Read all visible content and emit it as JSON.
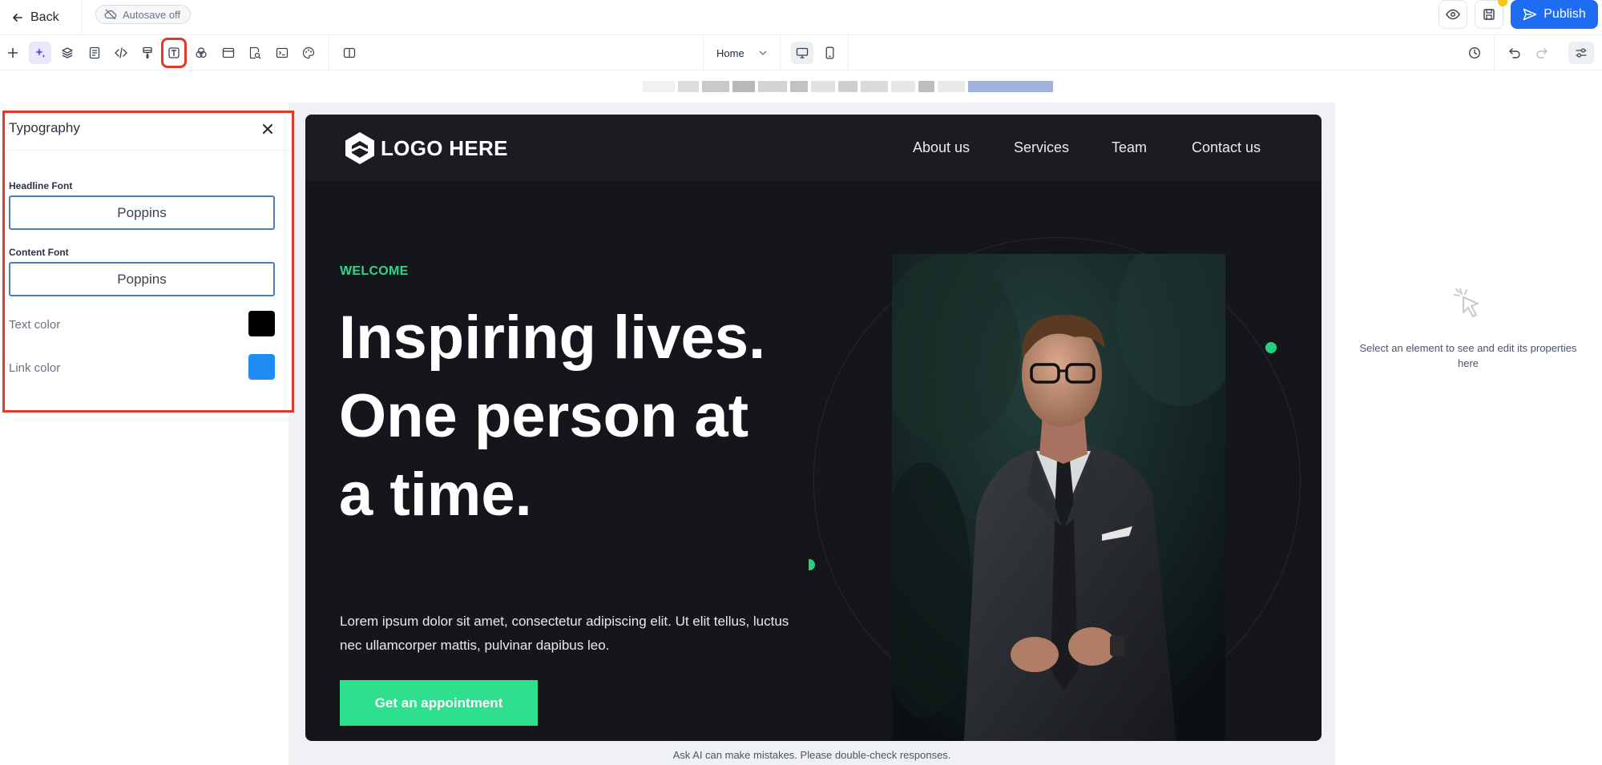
{
  "topbar": {
    "back_label": "Back",
    "autosave_label": "Autosave off",
    "publish_label": "Publish"
  },
  "toolbar": {
    "page_select": "Home"
  },
  "typography_panel": {
    "title": "Typography",
    "headline_font_label": "Headline Font",
    "headline_font_value": "Poppins",
    "content_font_label": "Content Font",
    "content_font_value": "Poppins",
    "text_color_label": "Text color",
    "text_color": "#000000",
    "link_color_label": "Link color",
    "link_color": "#1e8cf4"
  },
  "site": {
    "logo_text": "LOGO HERE",
    "nav": [
      "About us",
      "Services",
      "Team",
      "Contact us"
    ],
    "eyebrow": "WELCOME",
    "headline": "Inspiring lives. One person at a time.",
    "body": "Lorem ipsum dolor sit amet, consectetur adipiscing elit. Ut elit tellus, luctus nec ullamcorper mattis, pulvinar dapibus leo.",
    "cta_label": "Get an appointment",
    "accent_color": "#2ee08e"
  },
  "right_panel": {
    "hint": "Select an element to see and edit its properties here"
  },
  "footer_note": "Ask AI can make mistakes. Please double-check responses.",
  "colors": {
    "brand": "#1d6cf2",
    "highlight": "#e0392b",
    "canvas": "#15161b"
  }
}
